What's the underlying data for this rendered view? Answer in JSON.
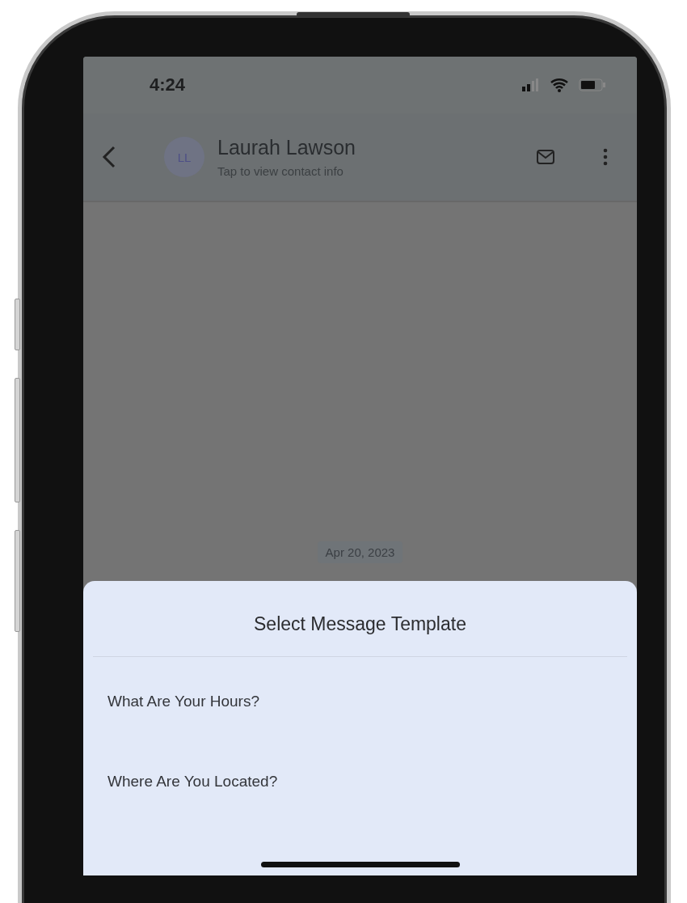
{
  "status_bar": {
    "time": "4:24"
  },
  "header": {
    "avatar": "LL",
    "name": "Laurah Lawson",
    "subtitle": "Tap to view contact info"
  },
  "date_chip": "Apr 20, 2023",
  "sheet": {
    "title": "Select Message Template",
    "items": [
      {
        "label": "What Are Your Hours?"
      },
      {
        "label": "Where Are You Located?"
      }
    ]
  }
}
